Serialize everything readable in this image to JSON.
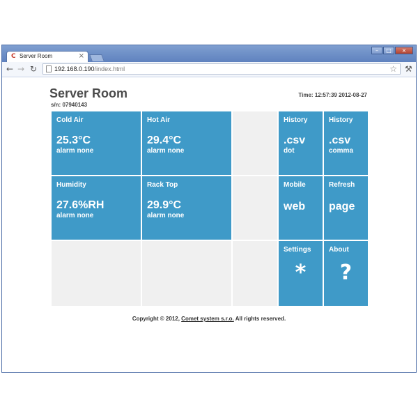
{
  "browser": {
    "tab_title": "Server Room",
    "tab_close": "×",
    "url_host": "192.168.0.190",
    "url_path": "/index.html",
    "icons": {
      "back": "back-arrow-icon",
      "forward": "forward-arrow-icon",
      "reload": "reload-icon",
      "star": "bookmark-star-icon",
      "wrench": "wrench-icon"
    }
  },
  "header": {
    "title": "Server Room",
    "serial": "s/n: 07940143",
    "time": "Time: 12:57:39 2012-08-27"
  },
  "tiles": {
    "cold_air": {
      "label": "Cold Air",
      "value": "25.3°C",
      "status": "alarm none"
    },
    "hot_air": {
      "label": "Hot Air",
      "value": "29.4°C",
      "status": "alarm none"
    },
    "humidity": {
      "label": "Humidity",
      "value": "27.6%RH",
      "status": "alarm none"
    },
    "rack_top": {
      "label": "Rack Top",
      "value": "29.9°C",
      "status": "alarm none"
    },
    "history_dot": {
      "label": "History",
      "value": ".csv",
      "sub": "dot"
    },
    "history_comma": {
      "label": "History",
      "value": ".csv",
      "sub": "comma"
    },
    "mobile": {
      "label": "Mobile",
      "value": "web"
    },
    "refresh": {
      "label": "Refresh",
      "value": "page"
    },
    "settings": {
      "label": "Settings",
      "glyph": "*"
    },
    "about": {
      "label": "About",
      "glyph": "?"
    }
  },
  "footer": {
    "prefix": "Copyright © 2012, ",
    "link": "Comet system s.r.o.",
    "suffix": " All rights reserved."
  },
  "colors": {
    "tile_blue": "#3f9ac8",
    "tile_gray": "#f0f0f0",
    "title_text": "#4b4b4b"
  }
}
